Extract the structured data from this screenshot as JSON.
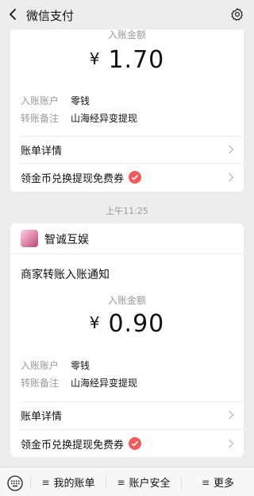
{
  "header": {
    "title": "微信支付"
  },
  "card1": {
    "amount_label": "入账金额",
    "currency": "¥",
    "amount": "1.70",
    "rows": [
      {
        "key": "入账账户",
        "value": "零钱"
      },
      {
        "key": "转账备注",
        "value": "山海经异变提现"
      }
    ],
    "detail_link": "账单详情",
    "coupon_link": "领金币兑换提现免费券"
  },
  "timestamp": "上午11:25",
  "card2": {
    "merchant_name": "智诚互娱",
    "notice_title": "商家转账入账通知",
    "amount_label": "入账金额",
    "currency": "¥",
    "amount": "0.90",
    "rows": [
      {
        "key": "入账账户",
        "value": "零钱"
      },
      {
        "key": "转账备注",
        "value": "山海经异变提现"
      }
    ],
    "detail_link": "账单详情",
    "coupon_link": "领金币兑换提现免费券"
  },
  "bottom_menu": [
    {
      "label": "我的账单"
    },
    {
      "label": "账户安全"
    },
    {
      "label": "更多"
    }
  ],
  "colors": {
    "background": "#ededed",
    "coupon_badge": "#f25a5a",
    "muted_text": "#9a9a9a"
  }
}
